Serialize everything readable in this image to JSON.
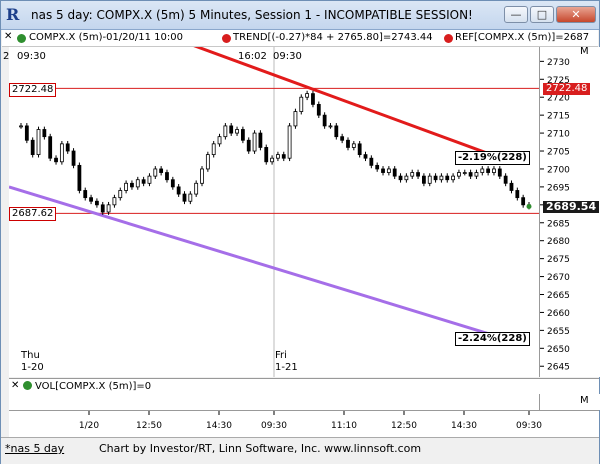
{
  "window": {
    "title": "nas 5 day: COMPX.X (5m) 5 Minutes, Session 1 - INCOMPATIBLE SESSION!",
    "minimize": "—",
    "maximize": "□",
    "close": "✕"
  },
  "legend": {
    "symbol": "COMPX.X (5m)-01/20/11 10:00",
    "trend": "TREND[(-0.27)*84 + 2765.80]=2743.44",
    "ref": "REF[COMPX.X (5m)]=2687",
    "colors": {
      "symbol": "#2f8f2f",
      "trend": "#d81e1e",
      "ref": "#d81e1e"
    }
  },
  "chart_top_labels": {
    "left_time": "09:30",
    "left_prefix": "2",
    "mid_time": "16:02",
    "mid_time2": "09:30"
  },
  "ref_lines": {
    "upper": {
      "value": "2722.48",
      "color": "#d81e1e"
    },
    "lower": {
      "value": "2687.62",
      "color": "#d81e1e"
    }
  },
  "channel_labels": {
    "upper": "-2.19%(228)",
    "lower": "-2.24%(228)"
  },
  "last_price": {
    "value": "2689.54",
    "color": "#1a1a1a"
  },
  "day_labels": [
    {
      "day": "Thu",
      "date": "1-20"
    },
    {
      "day": "Fri",
      "date": "1-21"
    }
  ],
  "volume": {
    "label": "VOL[COMPX.X (5m)]=0",
    "m_button": "M"
  },
  "m_button_top": "M",
  "chart_data": {
    "type": "line",
    "y_axis": {
      "ticks": [
        2645,
        2650,
        2655,
        2660,
        2665,
        2670,
        2675,
        2680,
        2685,
        2690,
        2695,
        2700,
        2705,
        2710,
        2715,
        2720,
        2725,
        2730
      ],
      "min": 2642,
      "max": 2734
    },
    "x_ticks": [
      "1/20",
      "12:50",
      "14:30",
      "09:30",
      "11:10",
      "12:50",
      "14:30",
      "09:30"
    ],
    "series": [
      {
        "values": [
          2712,
          2708,
          2704,
          2711,
          2709,
          2703,
          2702,
          2707,
          2705,
          2701,
          2694,
          2692,
          2691,
          2690,
          2688,
          2690,
          2692,
          2694,
          2696,
          2695,
          2697,
          2696,
          2698,
          2700,
          2699,
          2697,
          2695,
          2693,
          2691,
          2693,
          2696,
          2700,
          2704,
          2707,
          2709,
          2712,
          2710,
          2711,
          2708,
          2705,
          2710,
          2706,
          2702,
          2703,
          2704,
          2703,
          2712,
          2716,
          2720,
          2721,
          2718,
          2715,
          2712,
          2712,
          2709,
          2708,
          2706,
          2707,
          2704,
          2703,
          2701,
          2700,
          2699,
          2700,
          2698,
          2697,
          2698,
          2699,
          2698,
          2696,
          2698,
          2697,
          2698,
          2697,
          2698,
          2699,
          2699,
          2698,
          2699,
          2700,
          2699,
          2700,
          2698,
          2696,
          2694,
          2692,
          2690,
          2689.54
        ]
      }
    ],
    "trend_upper": {
      "start": 2740,
      "end": 2703,
      "color": "#e21b1b"
    },
    "trend_lower": {
      "start": 2695,
      "end": 2653,
      "color": "#a56ee8"
    }
  }
}
